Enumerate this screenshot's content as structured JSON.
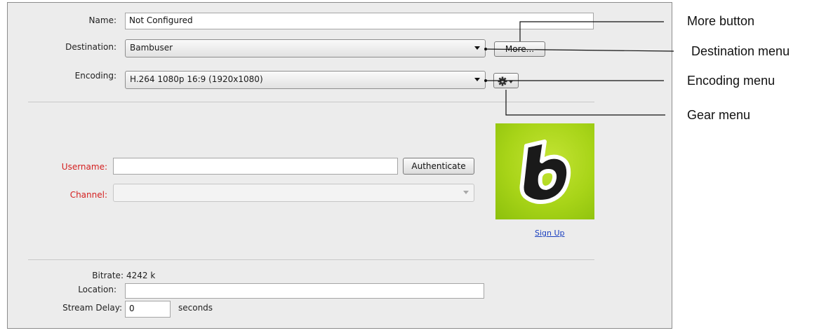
{
  "form": {
    "name_label": "Name:",
    "name_value": "Not Configured",
    "destination_label": "Destination:",
    "destination_value": "Bambuser",
    "more_button": "More...",
    "encoding_label": "Encoding:",
    "encoding_value": "H.264 1080p 16:9 (1920x1080)",
    "username_label": "Username:",
    "username_value": "",
    "authenticate_button": "Authenticate",
    "channel_label": "Channel:",
    "channel_value": "",
    "signup_link": "Sign Up",
    "logo_letter": "b",
    "bitrate_label": "Bitrate:",
    "bitrate_value": "4242 k",
    "location_label": "Location:",
    "location_value": "",
    "stream_delay_label": "Stream Delay:",
    "stream_delay_value": "0",
    "stream_delay_unit": "seconds"
  },
  "callouts": {
    "more": "More button",
    "destination": "Destination menu",
    "encoding": "Encoding menu",
    "gear": "Gear menu"
  },
  "icons": {
    "gear": "gear-icon",
    "dropdown": "chevron-down-icon"
  },
  "colors": {
    "required_label": "#d42020",
    "link": "#1a3fbf",
    "logo_green": "#a8d418"
  }
}
